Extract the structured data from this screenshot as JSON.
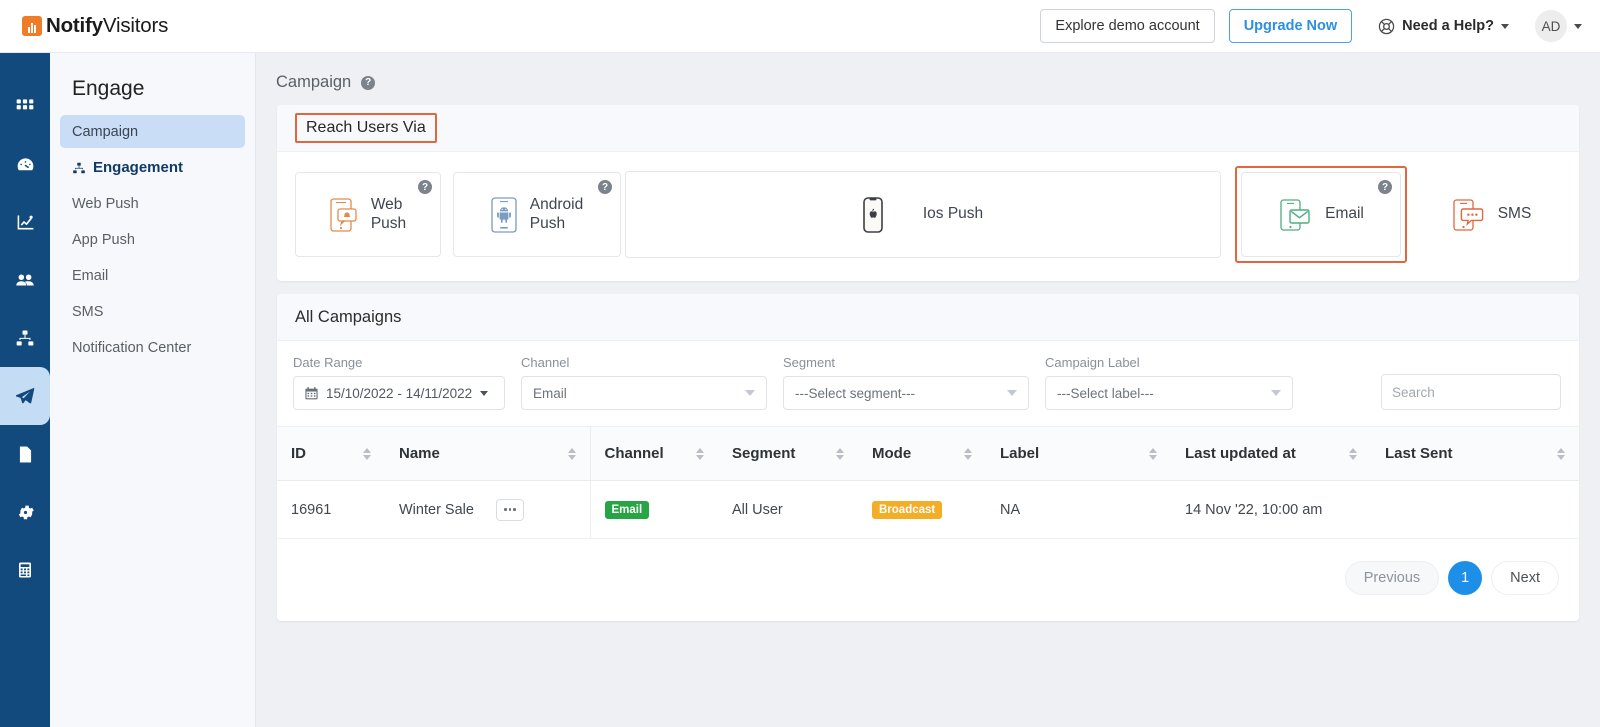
{
  "brand": {
    "name_bold": "Notify",
    "name_light": "Visitors",
    "accent": "#f07c28"
  },
  "topbar": {
    "demo_button": "Explore demo account",
    "upgrade_button": "Upgrade Now",
    "help_label": "Need a Help?",
    "avatar_initials": "AD"
  },
  "rail": [
    {
      "name": "apps-grid-icon"
    },
    {
      "name": "dashboard-gauge-icon"
    },
    {
      "name": "analytics-chart-icon"
    },
    {
      "name": "audience-users-icon"
    },
    {
      "name": "sitemap-icon"
    },
    {
      "name": "engage-send-icon"
    },
    {
      "name": "media-image-icon"
    },
    {
      "name": "settings-gear-icon"
    },
    {
      "name": "calculator-icon"
    }
  ],
  "sidebar": {
    "title": "Engage",
    "items": [
      {
        "label": "Campaign",
        "active": true
      },
      {
        "label": "Engagement",
        "strong": true
      },
      {
        "label": "Web Push"
      },
      {
        "label": "App Push"
      },
      {
        "label": "Email"
      },
      {
        "label": "SMS"
      },
      {
        "label": "Notification Center"
      }
    ]
  },
  "page": {
    "title": "Campaign"
  },
  "reach": {
    "heading": "Reach Users Via",
    "channels": [
      {
        "label": "Web\nPush",
        "icon": "web-push-phone-icon",
        "color": "#e28b4e",
        "has_help": true,
        "selected": false
      },
      {
        "label": "Android\nPush",
        "icon": "android-phone-icon",
        "color": "#7a9cc0",
        "has_help": true,
        "selected": false
      },
      {
        "label": "Ios Push",
        "icon": "ios-apple-phone-icon",
        "color": "#3b3f45",
        "has_help": false,
        "selected": false
      },
      {
        "label": "Email",
        "icon": "email-envelope-phone-icon",
        "color": "#4caf7d",
        "has_help": true,
        "selected": true
      },
      {
        "label": "SMS",
        "icon": "sms-chat-phone-icon",
        "color": "#e2673c",
        "has_help": false,
        "selected": false
      }
    ],
    "highlight_color": "#e2673c"
  },
  "campaigns": {
    "title": "All Campaigns",
    "filters": {
      "date_range_label": "Date Range",
      "date_range_value": "15/10/2022 - 14/11/2022",
      "channel_label": "Channel",
      "channel_value": "Email",
      "segment_label": "Segment",
      "segment_placeholder": "---Select segment---",
      "label_label": "Campaign Label",
      "label_placeholder": "---Select label---",
      "search_placeholder": "Search"
    },
    "columns": [
      "ID",
      "Name",
      "Channel",
      "Segment",
      "Mode",
      "Label",
      "Last updated at",
      "Last Sent"
    ],
    "rows": [
      {
        "id": "16961",
        "name": "Winter Sale",
        "channel": "Email",
        "segment": "All User",
        "mode": "Broadcast",
        "label": "NA",
        "last_updated": "14 Nov '22, 10:00 am",
        "last_sent": ""
      }
    ],
    "pagination": {
      "previous": "Previous",
      "current": "1",
      "next": "Next"
    }
  }
}
